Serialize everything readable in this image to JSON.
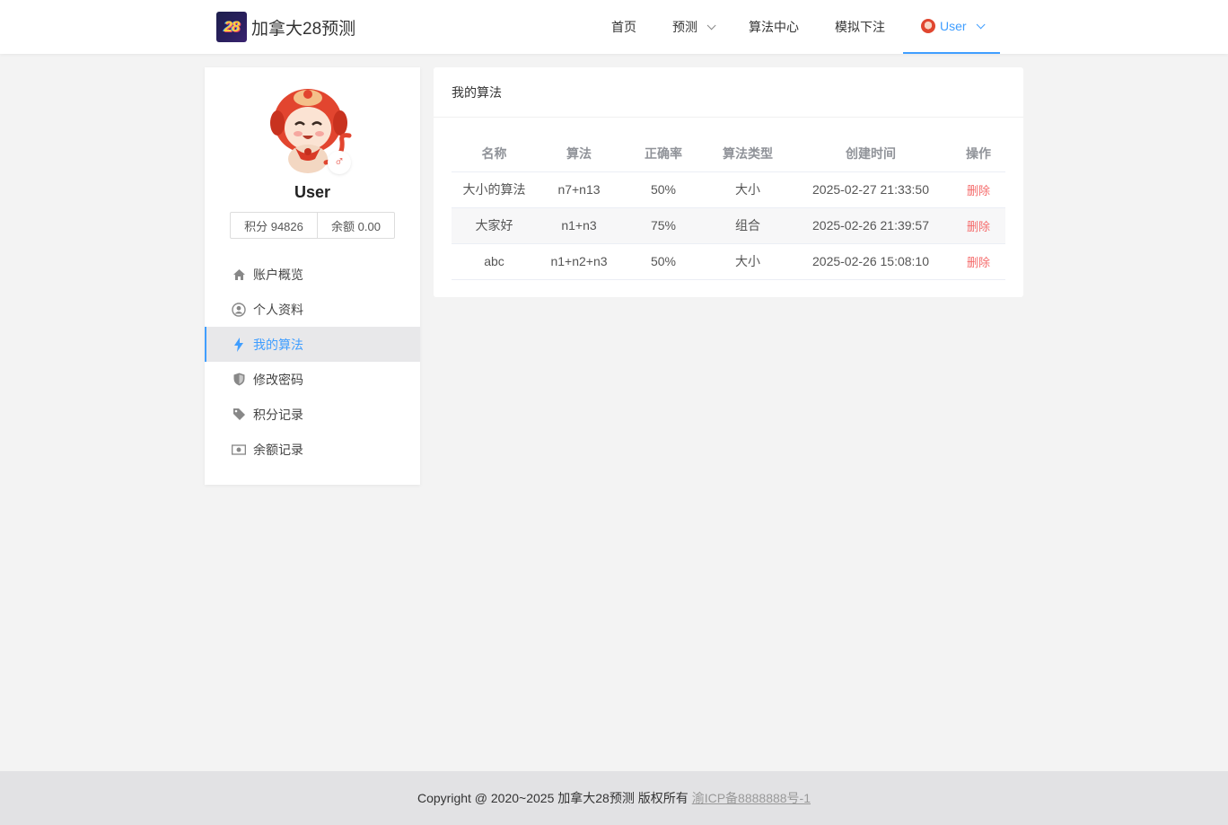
{
  "header": {
    "brand_logo_text": "28",
    "brand_name": "加拿大28预测",
    "nav": {
      "home": "首页",
      "predict": "预测",
      "algo_center": "算法中心",
      "mock_bet": "模拟下注",
      "user": "User"
    }
  },
  "sidebar": {
    "username": "User",
    "points_label": "积分 94826",
    "balance_label": "余额 0.00",
    "menu": [
      {
        "label": "账户概览",
        "icon": "home-icon"
      },
      {
        "label": "个人资料",
        "icon": "user-circle-icon"
      },
      {
        "label": "我的算法",
        "icon": "bolt-icon",
        "active": true
      },
      {
        "label": "修改密码",
        "icon": "shield-icon"
      },
      {
        "label": "积分记录",
        "icon": "tag-icon"
      },
      {
        "label": "余额记录",
        "icon": "money-icon"
      }
    ]
  },
  "main": {
    "title": "我的算法",
    "columns": [
      "名称",
      "算法",
      "正确率",
      "算法类型",
      "创建时间",
      "操作"
    ],
    "rows": [
      {
        "name": "大小的算法",
        "algo": "n7+n13",
        "accuracy": "50%",
        "type": "大小",
        "created": "2025-02-27 21:33:50",
        "action": "删除"
      },
      {
        "name": "大家好",
        "algo": "n1+n3",
        "accuracy": "75%",
        "type": "组合",
        "created": "2025-02-26 21:39:57",
        "action": "删除"
      },
      {
        "name": "abc",
        "algo": "n1+n2+n3",
        "accuracy": "50%",
        "type": "大小",
        "created": "2025-02-26 15:08:10",
        "action": "删除"
      }
    ]
  },
  "footer": {
    "copyright": "Copyright @ 2020~2025 加拿大28预测 版权所有",
    "icp": "渝ICP备8888888号-1"
  },
  "colors": {
    "accent": "#409eff",
    "danger": "#f56c6c",
    "background": "#f3f3f3",
    "footer_bg": "#e2e2e4"
  }
}
